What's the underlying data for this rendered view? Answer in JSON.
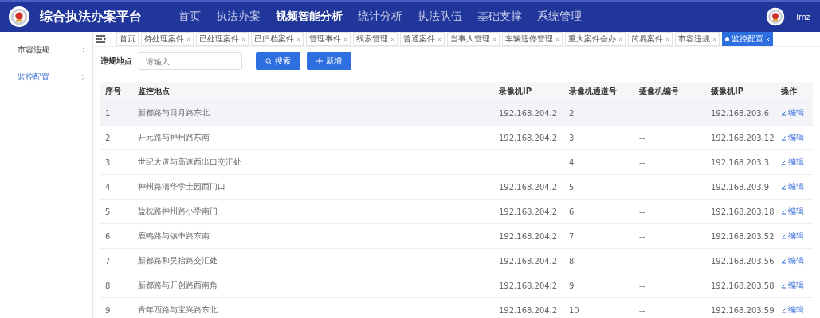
{
  "header": {
    "title": "综合执法办案平台",
    "nav": [
      {
        "label": "首页",
        "selected": false
      },
      {
        "label": "执法办案",
        "selected": false
      },
      {
        "label": "视频智能分析",
        "selected": true
      },
      {
        "label": "统计分析",
        "selected": false
      },
      {
        "label": "执法队伍",
        "selected": false
      },
      {
        "label": "基础支撑",
        "selected": false
      },
      {
        "label": "系统管理",
        "selected": false
      }
    ],
    "user": "lmz"
  },
  "sidebar": {
    "items": [
      {
        "label": "市容违规",
        "selected": false
      },
      {
        "label": "监控配置",
        "selected": true
      }
    ]
  },
  "tabs": [
    {
      "label": "首页",
      "selected": false,
      "closable": false
    },
    {
      "label": "待处理案件",
      "selected": false,
      "closable": true
    },
    {
      "label": "已处理案件",
      "selected": false,
      "closable": true
    },
    {
      "label": "已归档案件",
      "selected": false,
      "closable": true
    },
    {
      "label": "管理事件",
      "selected": false,
      "closable": true
    },
    {
      "label": "线索管理",
      "selected": false,
      "closable": true
    },
    {
      "label": "普通案件",
      "selected": false,
      "closable": true
    },
    {
      "label": "当事人管理",
      "selected": false,
      "closable": true
    },
    {
      "label": "车辆违停管理",
      "selected": false,
      "closable": true
    },
    {
      "label": "重大案件会办",
      "selected": false,
      "closable": true
    },
    {
      "label": "简易案件",
      "selected": false,
      "closable": true
    },
    {
      "label": "市容违规",
      "selected": false,
      "closable": true
    },
    {
      "label": "监控配置",
      "selected": true,
      "closable": true
    }
  ],
  "filter": {
    "label": "违规地点",
    "placeholder": "请输入",
    "buttons": [
      {
        "kind": "search",
        "label": "搜索"
      },
      {
        "kind": "add",
        "label": "新增"
      }
    ]
  },
  "table": {
    "columns": [
      "序号",
      "监控地点",
      "录像机IP",
      "录像机通道号",
      "摄像机编号",
      "摄像机IP",
      "操作"
    ],
    "rows": [
      {
        "no": "1",
        "location": "新都路与日月路东北",
        "recorder_ip": "192.168.204.2",
        "channel": "2",
        "camera_no": "--",
        "camera_ip": "192.168.203.6",
        "action": "编辑",
        "selected": true
      },
      {
        "no": "2",
        "location": "开元路与神州路东南",
        "recorder_ip": "192.168.204.2",
        "channel": "3",
        "camera_no": "--",
        "camera_ip": "192.168.203.12",
        "action": "编辑",
        "selected": false
      },
      {
        "no": "3",
        "location": "世纪大道与高速西出口交汇处",
        "channel": "4",
        "camera_no": "--",
        "camera_ip": "192.168.203.3",
        "action": "编辑",
        "selected": false
      },
      {
        "no": "4",
        "location": "神州路清华学士园西门口",
        "recorder_ip": "192.168.204.2",
        "channel": "5",
        "camera_no": "--",
        "camera_ip": "192.168.203.9",
        "action": "编辑",
        "selected": false
      },
      {
        "no": "5",
        "location": "盐枕路神州路小学南门",
        "recorder_ip": "192.168.204.2",
        "channel": "6",
        "camera_no": "--",
        "camera_ip": "192.168.203.18",
        "action": "编辑",
        "selected": false
      },
      {
        "no": "6",
        "location": "鹿鸣路与镇中路东南",
        "recorder_ip": "192.168.204.2",
        "channel": "7",
        "camera_no": "--",
        "camera_ip": "192.168.203.52",
        "action": "编辑",
        "selected": false
      },
      {
        "no": "7",
        "location": "新都路和昊抬路交汇处",
        "recorder_ip": "192.168.204.2",
        "channel": "8",
        "camera_no": "--",
        "camera_ip": "192.168.203.56",
        "action": "编辑",
        "selected": false
      },
      {
        "no": "8",
        "location": "新都路与开创路西南角",
        "recorder_ip": "192.168.204.2",
        "channel": "9",
        "camera_no": "--",
        "camera_ip": "192.168.203.58",
        "action": "编辑",
        "selected": false
      },
      {
        "no": "9",
        "location": "青年西路与宝兴路东北",
        "recorder_ip": "192.168.204.2",
        "channel": "10",
        "camera_no": "--",
        "camera_ip": "192.168.203.59",
        "action": "编辑",
        "selected": false
      }
    ]
  }
}
